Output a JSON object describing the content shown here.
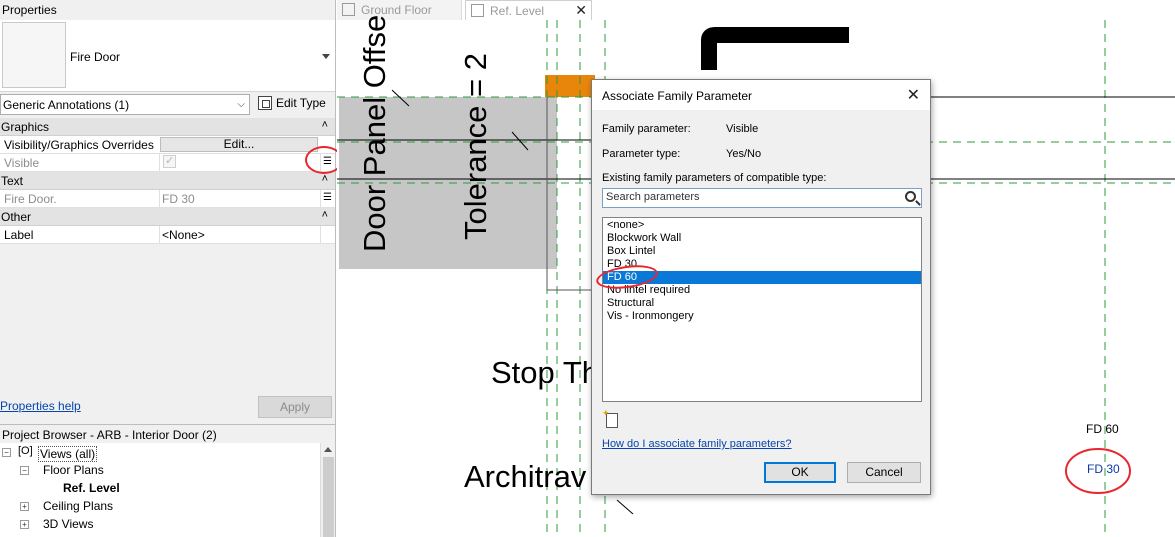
{
  "properties": {
    "title": "Properties",
    "type_name": "Fire Door",
    "filter_value": "Generic Annotations (1)",
    "edit_type_label": "Edit Type",
    "groups": {
      "graphics": "Graphics",
      "text": "Text",
      "other": "Other"
    },
    "rows": {
      "vg_overrides_label": "Visibility/Graphics Overrides",
      "vg_overrides_button": "Edit...",
      "visible_label": "Visible",
      "fire_door_label": "Fire Door.",
      "fire_door_value": "FD 30",
      "label_label": "Label",
      "label_value": "<None>"
    },
    "help_link": "Properties help",
    "apply_label": "Apply"
  },
  "project_browser": {
    "title": "Project Browser - ARB - Interior Door (2)",
    "items": {
      "views": "Views (all)",
      "floor_plans": "Floor Plans",
      "ref_level": "Ref. Level",
      "ceiling_plans": "Ceiling Plans",
      "views_3d": "3D Views"
    }
  },
  "tabs": {
    "ground_floor": "Ground Floor",
    "ref_level": "Ref. Level",
    "close_glyph": "✕"
  },
  "canvas": {
    "door_panel_text": "Door Panel Offse",
    "tolerance_text": "Tolerance = 2",
    "stop_text": "Stop Th",
    "architrave_text": "Architrav",
    "fd60_tag": "FD 60",
    "fd30_tag": "FD 30"
  },
  "dialog": {
    "title": "Associate Family Parameter",
    "family_param_label": "Family parameter:",
    "family_param_value": "Visible",
    "param_type_label": "Parameter type:",
    "param_type_value": "Yes/No",
    "existing_label": "Existing family parameters of compatible type:",
    "search_placeholder": "Search parameters",
    "items": [
      "<none>",
      "Blockwork Wall",
      "Box Lintel",
      "FD 30",
      "FD 60",
      "No lintel required",
      "Structural",
      "Vis - Ironmongery"
    ],
    "selected_index": 4,
    "help_link": "How do I associate family parameters?",
    "ok_label": "OK",
    "cancel_label": "Cancel"
  },
  "colors": {
    "selection": "#0a78d7",
    "annotation_red": "#e8262d",
    "tag_blue": "#0b3aa8",
    "orange_marker": "#e8860c",
    "grid_green": "#2f9a3a"
  }
}
